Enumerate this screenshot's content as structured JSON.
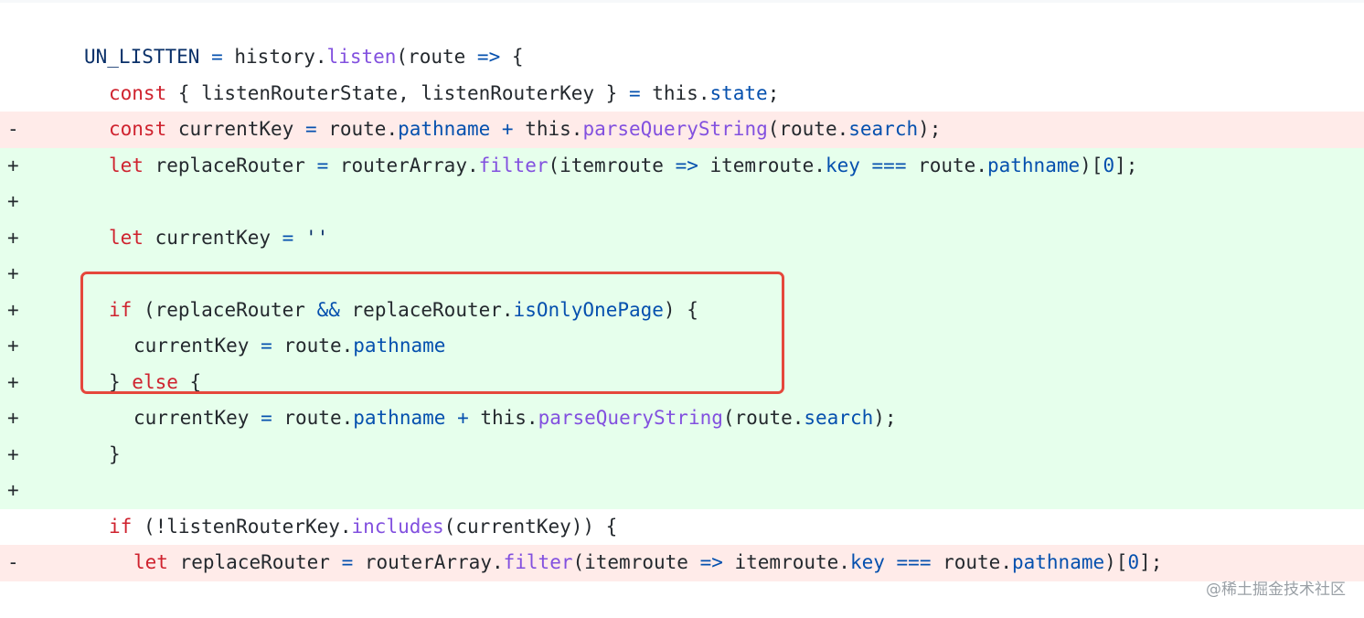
{
  "diff": {
    "lines": [
      {
        "type": "ctx",
        "marker": "",
        "indent": 0,
        "tokens": [
          {
            "c": "tok-id",
            "t": "UN_LISTTEN"
          },
          {
            "c": "tok-plain",
            "t": " "
          },
          {
            "c": "tok-op",
            "t": "="
          },
          {
            "c": "tok-plain",
            "t": " history."
          },
          {
            "c": "tok-fn",
            "t": "listen"
          },
          {
            "c": "tok-plain",
            "t": "(route "
          },
          {
            "c": "tok-op",
            "t": "=>"
          },
          {
            "c": "tok-plain",
            "t": " {"
          }
        ]
      },
      {
        "type": "ctx",
        "marker": "",
        "indent": 1,
        "tokens": [
          {
            "c": "tok-kw",
            "t": "const"
          },
          {
            "c": "tok-plain",
            "t": " { listenRouterState, listenRouterKey } "
          },
          {
            "c": "tok-op",
            "t": "="
          },
          {
            "c": "tok-plain",
            "t": " this."
          },
          {
            "c": "tok-prop",
            "t": "state"
          },
          {
            "c": "tok-plain",
            "t": ";"
          }
        ]
      },
      {
        "type": "del",
        "marker": "-",
        "indent": 1,
        "tokens": [
          {
            "c": "tok-kw",
            "t": "const"
          },
          {
            "c": "tok-plain",
            "t": " currentKey "
          },
          {
            "c": "tok-op",
            "t": "="
          },
          {
            "c": "tok-plain",
            "t": " route."
          },
          {
            "c": "tok-prop",
            "t": "pathname"
          },
          {
            "c": "tok-plain",
            "t": " "
          },
          {
            "c": "tok-op",
            "t": "+"
          },
          {
            "c": "tok-plain",
            "t": " this."
          },
          {
            "c": "tok-fn",
            "t": "parseQueryString"
          },
          {
            "c": "tok-plain",
            "t": "(route."
          },
          {
            "c": "tok-prop",
            "t": "search"
          },
          {
            "c": "tok-plain",
            "t": ");"
          }
        ]
      },
      {
        "type": "add",
        "marker": "+",
        "indent": 1,
        "tokens": [
          {
            "c": "tok-kw",
            "t": "let"
          },
          {
            "c": "tok-plain",
            "t": " replaceRouter "
          },
          {
            "c": "tok-op",
            "t": "="
          },
          {
            "c": "tok-plain",
            "t": " routerArray."
          },
          {
            "c": "tok-fn",
            "t": "filter"
          },
          {
            "c": "tok-plain",
            "t": "(itemroute "
          },
          {
            "c": "tok-op",
            "t": "=>"
          },
          {
            "c": "tok-plain",
            "t": " itemroute."
          },
          {
            "c": "tok-prop",
            "t": "key"
          },
          {
            "c": "tok-plain",
            "t": " "
          },
          {
            "c": "tok-op",
            "t": "==="
          },
          {
            "c": "tok-plain",
            "t": " route."
          },
          {
            "c": "tok-prop",
            "t": "pathname"
          },
          {
            "c": "tok-plain",
            "t": ")["
          },
          {
            "c": "tok-prop",
            "t": "0"
          },
          {
            "c": "tok-plain",
            "t": "];"
          }
        ]
      },
      {
        "type": "add",
        "marker": "+",
        "indent": 1,
        "tokens": []
      },
      {
        "type": "add",
        "marker": "+",
        "indent": 1,
        "tokens": [
          {
            "c": "tok-kw",
            "t": "let"
          },
          {
            "c": "tok-plain",
            "t": " currentKey "
          },
          {
            "c": "tok-op",
            "t": "="
          },
          {
            "c": "tok-plain",
            "t": " "
          },
          {
            "c": "tok-str",
            "t": "''"
          }
        ]
      },
      {
        "type": "add",
        "marker": "+",
        "indent": 1,
        "tokens": []
      },
      {
        "type": "add",
        "marker": "+",
        "indent": 1,
        "tokens": [
          {
            "c": "tok-kw",
            "t": "if"
          },
          {
            "c": "tok-plain",
            "t": " (replaceRouter "
          },
          {
            "c": "tok-op",
            "t": "&&"
          },
          {
            "c": "tok-plain",
            "t": " replaceRouter."
          },
          {
            "c": "tok-prop",
            "t": "isOnlyOnePage"
          },
          {
            "c": "tok-plain",
            "t": ") {"
          }
        ]
      },
      {
        "type": "add",
        "marker": "+",
        "indent": 2,
        "tokens": [
          {
            "c": "tok-plain",
            "t": "currentKey "
          },
          {
            "c": "tok-op",
            "t": "="
          },
          {
            "c": "tok-plain",
            "t": " route."
          },
          {
            "c": "tok-prop",
            "t": "pathname"
          }
        ]
      },
      {
        "type": "add",
        "marker": "+",
        "indent": 1,
        "tokens": [
          {
            "c": "tok-plain",
            "t": "} "
          },
          {
            "c": "tok-kw",
            "t": "else"
          },
          {
            "c": "tok-plain",
            "t": " {"
          }
        ]
      },
      {
        "type": "add",
        "marker": "+",
        "indent": 2,
        "tokens": [
          {
            "c": "tok-plain",
            "t": "currentKey "
          },
          {
            "c": "tok-op",
            "t": "="
          },
          {
            "c": "tok-plain",
            "t": " route."
          },
          {
            "c": "tok-prop",
            "t": "pathname"
          },
          {
            "c": "tok-plain",
            "t": " "
          },
          {
            "c": "tok-op",
            "t": "+"
          },
          {
            "c": "tok-plain",
            "t": " this."
          },
          {
            "c": "tok-fn",
            "t": "parseQueryString"
          },
          {
            "c": "tok-plain",
            "t": "(route."
          },
          {
            "c": "tok-prop",
            "t": "search"
          },
          {
            "c": "tok-plain",
            "t": ");"
          }
        ]
      },
      {
        "type": "add",
        "marker": "+",
        "indent": 1,
        "tokens": [
          {
            "c": "tok-plain",
            "t": "}"
          }
        ]
      },
      {
        "type": "add",
        "marker": "+",
        "indent": 1,
        "tokens": []
      },
      {
        "type": "ctx",
        "marker": "",
        "indent": 1,
        "tokens": [
          {
            "c": "tok-kw",
            "t": "if"
          },
          {
            "c": "tok-plain",
            "t": " (!listenRouterKey."
          },
          {
            "c": "tok-fn",
            "t": "includes"
          },
          {
            "c": "tok-plain",
            "t": "(currentKey)) {"
          }
        ]
      },
      {
        "type": "del",
        "marker": "-",
        "indent": 2,
        "tokens": [
          {
            "c": "tok-kw",
            "t": "let"
          },
          {
            "c": "tok-plain",
            "t": " replaceRouter "
          },
          {
            "c": "tok-op",
            "t": "="
          },
          {
            "c": "tok-plain",
            "t": " routerArray."
          },
          {
            "c": "tok-fn",
            "t": "filter"
          },
          {
            "c": "tok-plain",
            "t": "(itemroute "
          },
          {
            "c": "tok-op",
            "t": "=>"
          },
          {
            "c": "tok-plain",
            "t": " itemroute."
          },
          {
            "c": "tok-prop",
            "t": "key"
          },
          {
            "c": "tok-plain",
            "t": " "
          },
          {
            "c": "tok-op",
            "t": "==="
          },
          {
            "c": "tok-plain",
            "t": " route."
          },
          {
            "c": "tok-prop",
            "t": "pathname"
          },
          {
            "c": "tok-plain",
            "t": ")["
          },
          {
            "c": "tok-prop",
            "t": "0"
          },
          {
            "c": "tok-plain",
            "t": "];"
          }
        ]
      }
    ]
  },
  "watermark": "@稀土掘金技术社区"
}
